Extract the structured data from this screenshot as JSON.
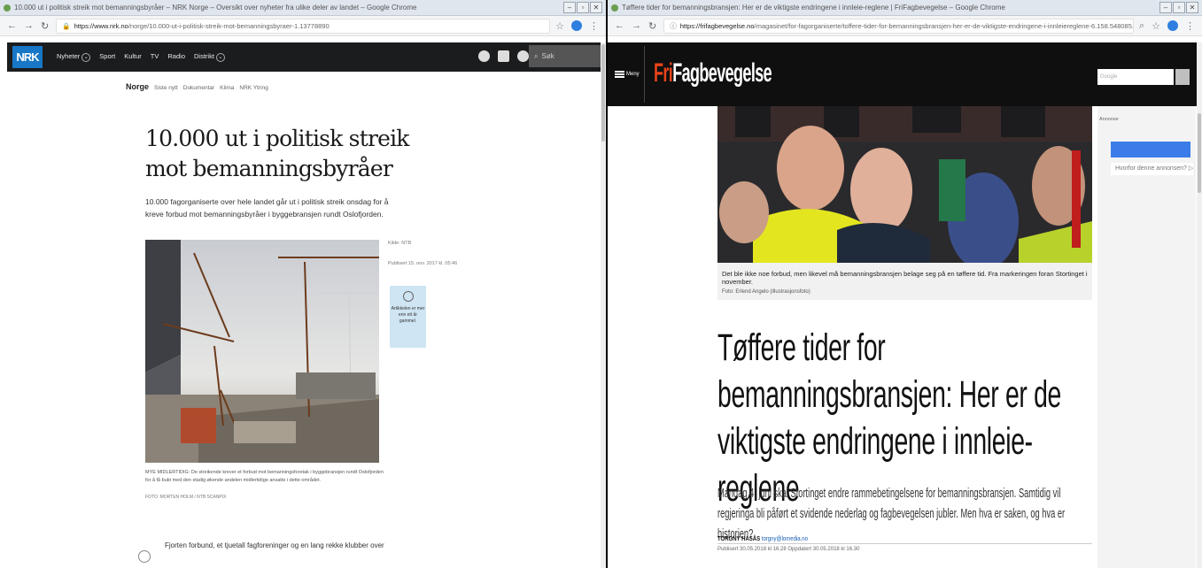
{
  "left": {
    "window_title": "10.000 ut i politisk streik mot bemanningsbyråer – NRK Norge – Oversikt over nyheter fra ulike deler av landet – Google Chrome",
    "url_host": "https://www.nrk.no",
    "url_path": "/norge/10.000-ut-i-politisk-streik-mot-bemanningsbyraer-1.13778890",
    "nav": {
      "logo": "NRK",
      "items": [
        "Nyheter",
        "Sport",
        "Kultur",
        "TV",
        "Radio",
        "Distrikt"
      ],
      "search_placeholder": "Søk"
    },
    "subnav": {
      "current": "Norge",
      "items": [
        "Siste nytt",
        "Dokumentar",
        "Klima",
        "NRK Ytring"
      ]
    },
    "article": {
      "title": "10.000 ut i politisk streik mot bemanningsbyråer",
      "lead": "10.000 fagorganiserte over hele landet går ut i politisk streik onsdag for å kreve forbud mot bemanningsbyråer i byggebransjen rundt Oslofjorden.",
      "source": "Kilde: NTB",
      "published": "Publisert 15. nov. 2017 kl. 05:46",
      "age_note": "Artikkelen er mer enn ett år gammel.",
      "image_caption": "MYE MIDLERTIDIG: De streikende krever et forbud mot bemanningsforetak i byggebransjen rundt Oslofjorden for å få bukt med den stadig økende andelen midlertidige ansatte i dette området.",
      "photo_credit": "FOTO: MORTEN HOLM / NTB SCANPIX",
      "body_start": "Fjorten forbund, et tjuetall fagforeninger og en lang rekke klubber over"
    }
  },
  "right": {
    "window_title": "Tøffere tider for bemanningsbransjen: Her er de viktigste endringene i innleie-reglene | FriFagbevegelse – Google Chrome",
    "url_host": "https://frifagbevegelse.no",
    "url_path": "/magasinet/for-fagorganiserte/toffere-tider-for-bemanningsbransjen-her-er-de-viktigste-endringene-i-innleiereglene-6.158.548085.73d7adb53",
    "menu_label": "Meny",
    "logo_a": "Fri",
    "logo_b": "Fagbevegelse",
    "search_placeholder": "Google",
    "hero_caption": "Det ble ikke noe forbud, men likevel må bemanningsbransjen belage seg på en tøffere tid. Fra markeringen foran Stortinget i november.",
    "hero_credit": "Foto: Erlend Angelo (illustrasjonsfoto)",
    "title": "Tøffere tider for bemanningsbransjen: Her er de viktigste endringene i innleie-reglene",
    "lead": "Mandag 4. juni skal Stortinget endre rammebetingelsene for bemanningsbransjen. Samtidig vil regjeringa bli påført et svidende nederlag og fagbevegelsen jubler. Men hva er saken, og hva er historien?",
    "author": "TORGNY HASÅS",
    "author_email": "torgny@lomedia.no",
    "published": "Publisert 30.05.2018 kl 16.28 Oppdatert 30.05.2018 kl 16.30",
    "ad_label": "Annonse",
    "ad_why": "Hvorfor denne annonsen?"
  }
}
